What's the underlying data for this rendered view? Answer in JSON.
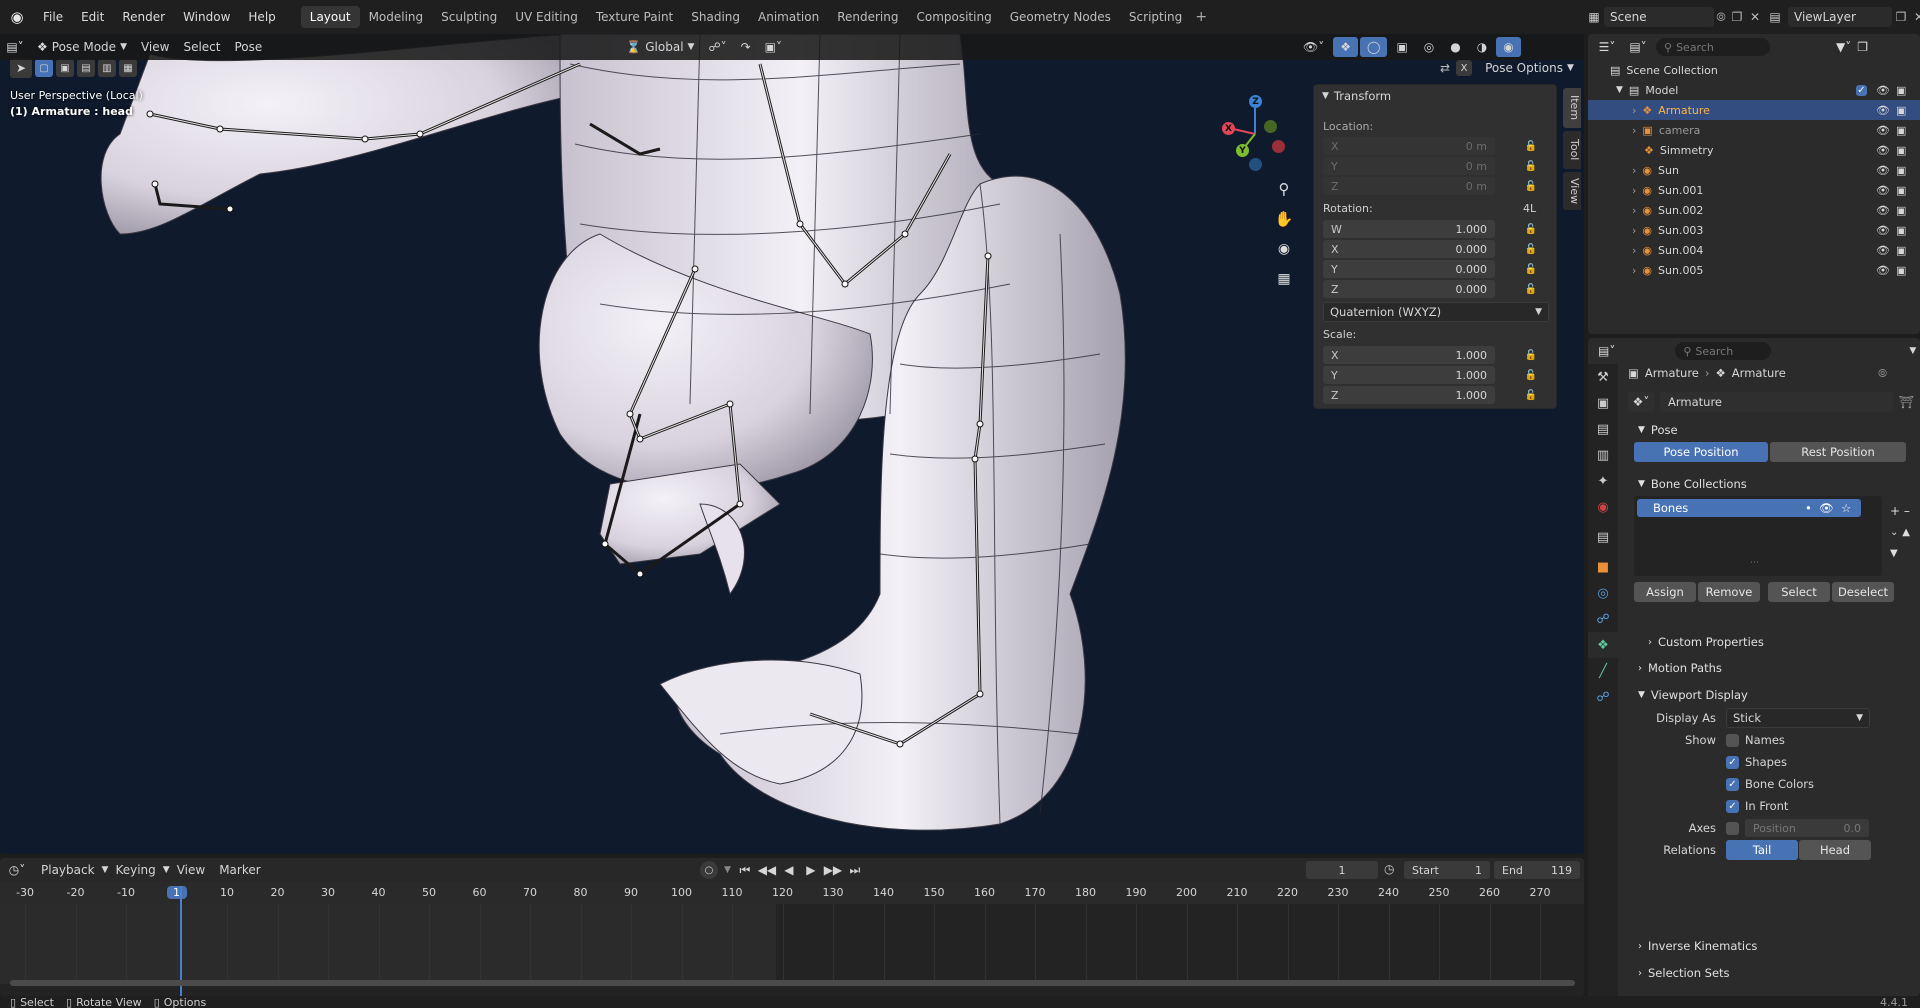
{
  "topbar": {
    "menus": [
      "File",
      "Edit",
      "Render",
      "Window",
      "Help"
    ],
    "workspaces": [
      "Layout",
      "Modeling",
      "Sculpting",
      "UV Editing",
      "Texture Paint",
      "Shading",
      "Animation",
      "Rendering",
      "Compositing",
      "Geometry Nodes",
      "Scripting"
    ],
    "active_workspace": "Layout",
    "scene_label": "Scene",
    "view_layer_label": "ViewLayer"
  },
  "viewport_header": {
    "mode": "Pose Mode",
    "menus": [
      "View",
      "Select",
      "Pose"
    ],
    "orientation": "Global",
    "pose_options": "Pose Options"
  },
  "viewport": {
    "perspective_label": "User Perspective (Local)",
    "active_info": "(1) Armature : head",
    "background_color": "#0f1a2c",
    "gizmo": {
      "x": "X",
      "y": "Y",
      "z": "Z"
    }
  },
  "side_tabs": [
    "Item",
    "Tool",
    "View"
  ],
  "transform_panel": {
    "title": "Transform",
    "location_label": "Location:",
    "location": [
      {
        "axis": "X",
        "value": "0 m"
      },
      {
        "axis": "Y",
        "value": "0 m"
      },
      {
        "axis": "Z",
        "value": "0 m"
      }
    ],
    "rotation_label": "Rotation:",
    "rotation_mode_short": "4L",
    "rotation": [
      {
        "axis": "W",
        "value": "1.000"
      },
      {
        "axis": "X",
        "value": "0.000"
      },
      {
        "axis": "Y",
        "value": "0.000"
      },
      {
        "axis": "Z",
        "value": "0.000"
      }
    ],
    "rotation_mode": "Quaternion (WXYZ)",
    "scale_label": "Scale:",
    "scale": [
      {
        "axis": "X",
        "value": "1.000"
      },
      {
        "axis": "Y",
        "value": "1.000"
      },
      {
        "axis": "Z",
        "value": "1.000"
      }
    ]
  },
  "timeline": {
    "menus": [
      "Playback",
      "Keying",
      "View",
      "Marker"
    ],
    "current_frame": "1",
    "start_label": "Start",
    "start": "1",
    "end_label": "End",
    "end": "119",
    "ruler": [
      "-30",
      "-20",
      "-10",
      "1",
      "10",
      "20",
      "30",
      "40",
      "50",
      "60",
      "70",
      "80",
      "90",
      "100",
      "110",
      "120",
      "130",
      "140",
      "150",
      "160",
      "170",
      "180",
      "190",
      "200",
      "210",
      "220",
      "230",
      "240",
      "250",
      "260",
      "270"
    ]
  },
  "outliner": {
    "search_placeholder": "Search",
    "root": "Scene Collection",
    "collection": "Model",
    "items": [
      {
        "name": "Armature",
        "selected": true
      },
      {
        "name": "camera",
        "selected": false
      },
      {
        "name": "Simmetry",
        "selected": false
      },
      {
        "name": "Sun",
        "selected": false
      },
      {
        "name": "Sun.001",
        "selected": false
      },
      {
        "name": "Sun.002",
        "selected": false
      },
      {
        "name": "Sun.003",
        "selected": false
      },
      {
        "name": "Sun.004",
        "selected": false
      },
      {
        "name": "Sun.005",
        "selected": false
      }
    ]
  },
  "properties": {
    "search_placeholder": "Search",
    "breadcrumb": [
      "Armature",
      "Armature"
    ],
    "data_name": "Armature",
    "pose": {
      "title": "Pose",
      "pose_position": "Pose Position",
      "rest_position": "Rest Position"
    },
    "bone_collections": {
      "title": "Bone Collections",
      "items": [
        "Bones"
      ],
      "assign": "Assign",
      "remove": "Remove",
      "select": "Select",
      "deselect": "Deselect"
    },
    "custom_properties": "Custom Properties",
    "motion_paths": "Motion Paths",
    "viewport_display": {
      "title": "Viewport Display",
      "display_as_label": "Display As",
      "display_as": "Stick",
      "show_label": "Show",
      "names": "Names",
      "shapes": "Shapes",
      "bone_colors": "Bone Colors",
      "in_front": "In Front",
      "axes_label": "Axes",
      "position_label": "Position",
      "position_value": "0.0",
      "relations_label": "Relations",
      "tail": "Tail",
      "head": "Head"
    },
    "inverse_kinematics": "Inverse Kinematics",
    "selection_sets": "Selection Sets"
  },
  "statusbar": {
    "select": "Select",
    "rotate": "Rotate View",
    "options": "Options",
    "version": "4.4.1"
  }
}
